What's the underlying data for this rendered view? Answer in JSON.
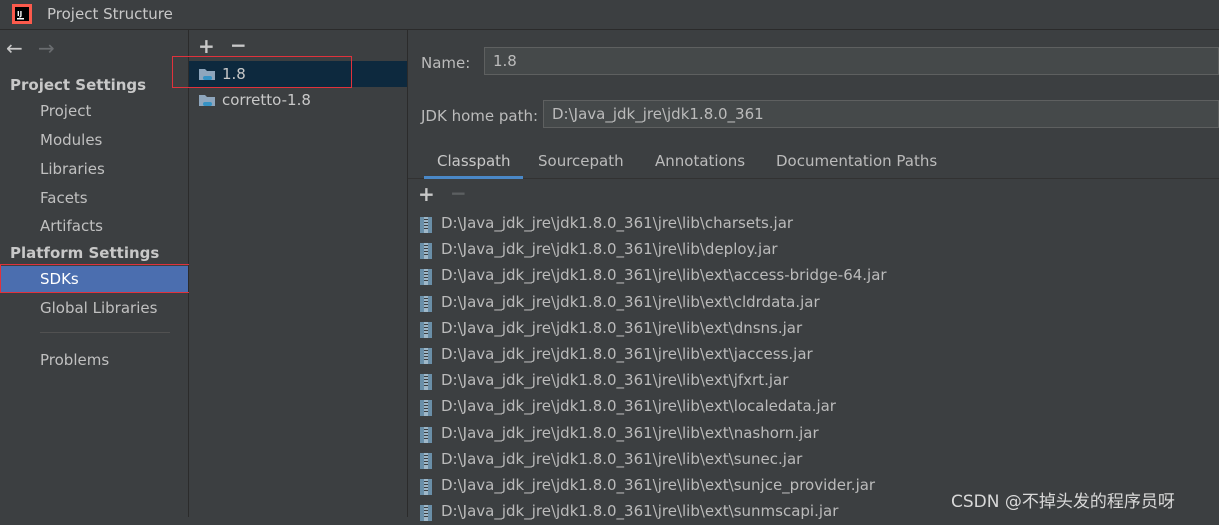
{
  "window": {
    "title": "Project Structure"
  },
  "nav": {
    "back_icon": "arrow-left-icon",
    "forward_icon": "arrow-right-icon",
    "project_settings_header": "Project Settings",
    "project_settings_items": [
      {
        "label": "Project"
      },
      {
        "label": "Modules"
      },
      {
        "label": "Libraries"
      },
      {
        "label": "Facets"
      },
      {
        "label": "Artifacts"
      }
    ],
    "platform_settings_header": "Platform Settings",
    "platform_settings_items": [
      {
        "label": "SDKs",
        "selected": true
      },
      {
        "label": "Global Libraries"
      }
    ],
    "problems_label": "Problems"
  },
  "sdk_list": {
    "add_icon": "plus-icon",
    "remove_icon": "minus-icon",
    "items": [
      {
        "label": "1.8",
        "selected": true
      },
      {
        "label": "corretto-1.8"
      }
    ]
  },
  "details": {
    "name_label": "Name:",
    "name_value": "1.8",
    "home_path_label": "JDK home path:",
    "home_path_value": "D:\\Java_jdk_jre\\jdk1.8.0_361",
    "tabs": [
      {
        "label": "Classpath",
        "active": true
      },
      {
        "label": "Sourcepath"
      },
      {
        "label": "Annotations"
      },
      {
        "label": "Documentation Paths"
      }
    ],
    "classpath": [
      "D:\\Java_jdk_jre\\jdk1.8.0_361\\jre\\lib\\charsets.jar",
      "D:\\Java_jdk_jre\\jdk1.8.0_361\\jre\\lib\\deploy.jar",
      "D:\\Java_jdk_jre\\jdk1.8.0_361\\jre\\lib\\ext\\access-bridge-64.jar",
      "D:\\Java_jdk_jre\\jdk1.8.0_361\\jre\\lib\\ext\\cldrdata.jar",
      "D:\\Java_jdk_jre\\jdk1.8.0_361\\jre\\lib\\ext\\dnsns.jar",
      "D:\\Java_jdk_jre\\jdk1.8.0_361\\jre\\lib\\ext\\jaccess.jar",
      "D:\\Java_jdk_jre\\jdk1.8.0_361\\jre\\lib\\ext\\jfxrt.jar",
      "D:\\Java_jdk_jre\\jdk1.8.0_361\\jre\\lib\\ext\\localedata.jar",
      "D:\\Java_jdk_jre\\jdk1.8.0_361\\jre\\lib\\ext\\nashorn.jar",
      "D:\\Java_jdk_jre\\jdk1.8.0_361\\jre\\lib\\ext\\sunec.jar",
      "D:\\Java_jdk_jre\\jdk1.8.0_361\\jre\\lib\\ext\\sunjce_provider.jar",
      "D:\\Java_jdk_jre\\jdk1.8.0_361\\jre\\lib\\ext\\sunmscapi.jar"
    ]
  },
  "watermark": "CSDN @不掉头发的程序员呀",
  "colors": {
    "selection": "#4b6eaf",
    "sdk_selection": "#0d293e",
    "highlight_box": "#e0323c",
    "tab_underline": "#4a88c7"
  }
}
